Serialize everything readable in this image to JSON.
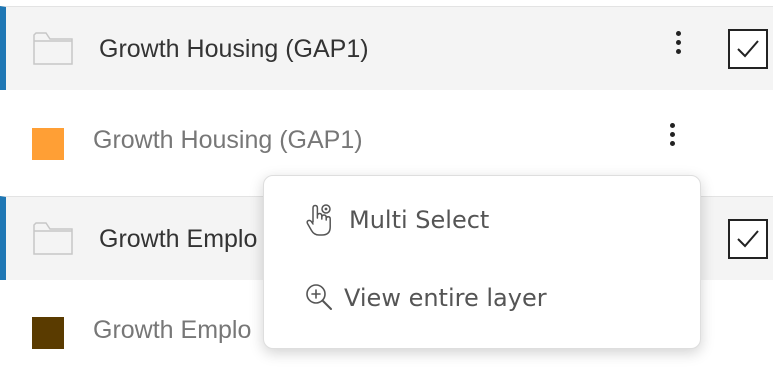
{
  "layers": {
    "group_1": {
      "label": "Growth Housing (GAP1)",
      "icon": "folder-icon",
      "checked": true,
      "accent_color": "#1f77b4"
    },
    "item_1": {
      "label": "Growth Housing (GAP1)",
      "swatch_color": "#ff9f35"
    },
    "group_2": {
      "label": "Growth Emplo",
      "icon": "folder-icon",
      "checked": true,
      "accent_color": "#1f77b4"
    },
    "item_2": {
      "label": "Growth Emplo",
      "swatch_color": "#5a3b00"
    }
  },
  "context_menu": {
    "items": [
      {
        "label": "Multi Select",
        "icon": "touch-select-icon"
      },
      {
        "label": "View entire layer",
        "icon": "zoom-in-icon"
      }
    ]
  },
  "icons": {
    "kebab": "more-vertical-icon",
    "check": "check-icon"
  }
}
